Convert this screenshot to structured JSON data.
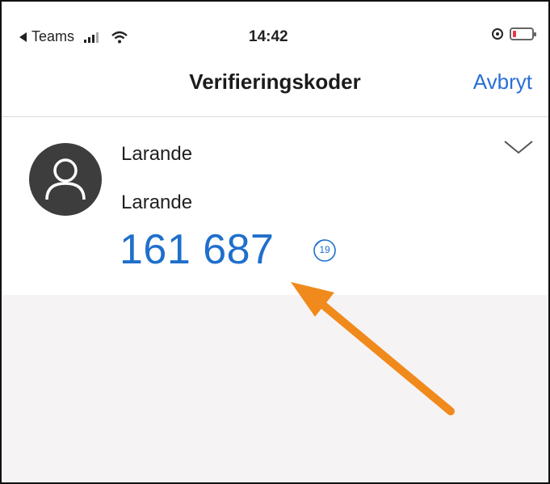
{
  "status_bar": {
    "back_app": "Teams",
    "time": "14:42"
  },
  "navbar": {
    "title": "Verifieringskoder",
    "cancel": "Avbryt"
  },
  "account": {
    "name": "Larande",
    "username": "Larande",
    "code": "161 687",
    "seconds_remaining": "19"
  },
  "colors": {
    "accent": "#2a6fd6",
    "code": "#1f6fcc",
    "annotation_arrow": "#f08a1c",
    "battery_low": "#e8364a"
  },
  "icons": [
    "back-triangle-icon",
    "signal-icon",
    "wifi-icon",
    "orientation-lock-icon",
    "battery-icon",
    "avatar-person-icon",
    "timer-icon",
    "chevron-down-icon",
    "annotation-arrow"
  ]
}
